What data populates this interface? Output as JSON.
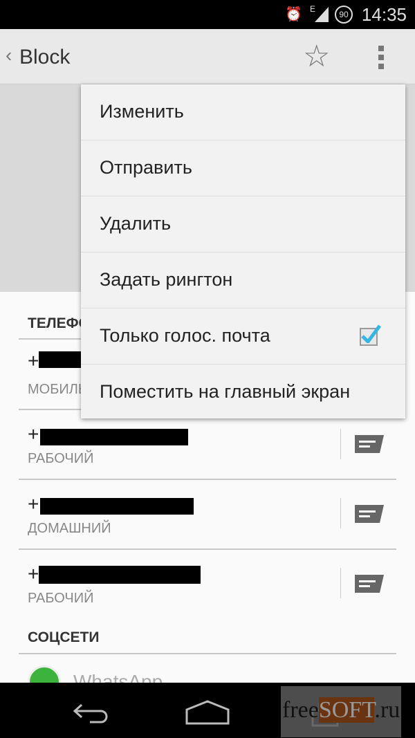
{
  "status_bar": {
    "time": "14:35",
    "network": "E",
    "battery": "90",
    "icons": [
      "alarm-icon",
      "signal-icon",
      "battery-icon"
    ]
  },
  "action_bar": {
    "title": "Block",
    "icons": [
      "back-chevron-icon",
      "star-icon",
      "overflow-menu-icon"
    ]
  },
  "sections": {
    "phone": {
      "header": "ТЕЛЕФОН",
      "rows": [
        {
          "number": "+",
          "label": "МОБИЛЬНЫЙ"
        },
        {
          "number": "+",
          "label": "РАБОЧИЙ"
        },
        {
          "number": "+",
          "label": "ДОМАШНИЙ"
        },
        {
          "number": "+",
          "label": "РАБОЧИЙ"
        }
      ]
    },
    "social": {
      "header": "СОЦСЕТИ",
      "items": [
        {
          "label": "WhatsApp"
        }
      ]
    }
  },
  "menu": {
    "items": [
      {
        "label": "Изменить"
      },
      {
        "label": "Отправить"
      },
      {
        "label": "Удалить"
      },
      {
        "label": "Задать рингтон"
      },
      {
        "label": "Только голос. почта",
        "checked": true
      },
      {
        "label": "Поместить на главный экран"
      }
    ]
  },
  "colors": {
    "checkmark": "#33b5e5",
    "whatsapp": "#3cb33c"
  },
  "watermark": "freeSOFT.ru"
}
